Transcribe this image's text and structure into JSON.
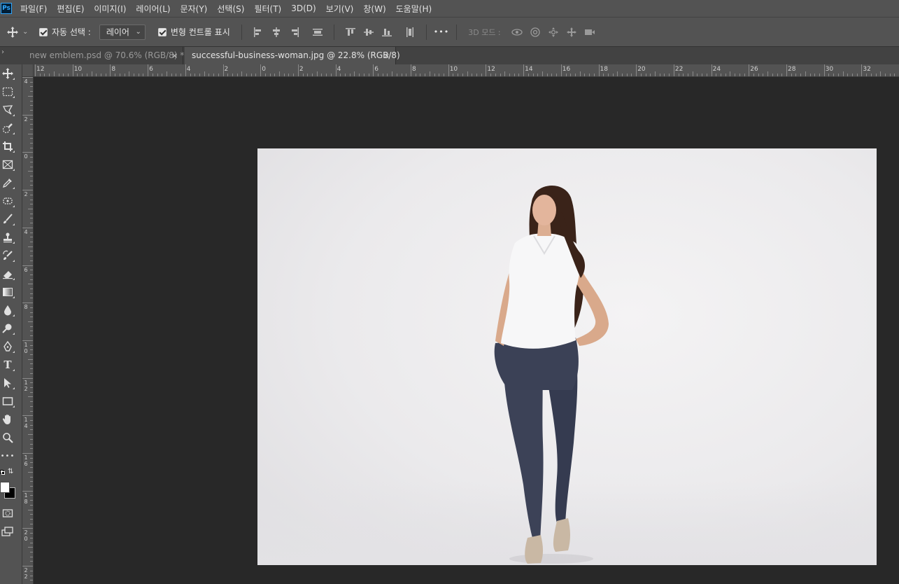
{
  "app": {
    "logo_text": "Ps"
  },
  "menu": [
    {
      "label": "파일(F)"
    },
    {
      "label": "편집(E)"
    },
    {
      "label": "이미지(I)"
    },
    {
      "label": "레이어(L)"
    },
    {
      "label": "문자(Y)"
    },
    {
      "label": "선택(S)"
    },
    {
      "label": "필터(T)"
    },
    {
      "label": "3D(D)"
    },
    {
      "label": "보기(V)"
    },
    {
      "label": "창(W)"
    },
    {
      "label": "도움말(H)"
    }
  ],
  "options": {
    "auto_select_label": "자동 선택 :",
    "auto_select_value": "레이어",
    "transform_controls_label": "변형 컨트롤 표시",
    "mode_3d_label": "3D 모드 :",
    "more_label": "•••"
  },
  "tabs": [
    {
      "label": "new emblem.psd @ 70.6% (RGB/8) *",
      "active": false
    },
    {
      "label": "successful-business-woman.jpg @ 22.8% (RGB/8)",
      "active": true
    }
  ],
  "tab_close": "×",
  "ruler_h_labels": [
    "12",
    "10",
    "8",
    "6",
    "4",
    "2",
    "0",
    "2",
    "4",
    "6",
    "8",
    "10",
    "12",
    "14",
    "16",
    "18",
    "20",
    "22",
    "24",
    "26",
    "28",
    "30",
    "32"
  ],
  "ruler_v_labels": [
    "4",
    "2",
    "0",
    "2",
    "4",
    "6",
    "8",
    "10",
    "12",
    "14",
    "16",
    "18",
    "20",
    "22"
  ],
  "toolbar": {
    "more_tools": "•••",
    "type_tool": "T"
  },
  "colors": {
    "foreground": "#ffffff",
    "background": "#000000",
    "accent": "#31a8ff"
  },
  "icons": [
    "move-icon",
    "marquee-icon",
    "lasso-icon",
    "quick-select-icon",
    "crop-icon",
    "frame-icon",
    "eyedropper-icon",
    "patch-icon",
    "brush-icon",
    "stamp-icon",
    "history-brush-icon",
    "eraser-icon",
    "gradient-icon",
    "blur-icon",
    "dodge-icon",
    "pen-icon",
    "type-icon",
    "path-select-icon",
    "rectangle-icon",
    "hand-icon",
    "zoom-icon"
  ]
}
